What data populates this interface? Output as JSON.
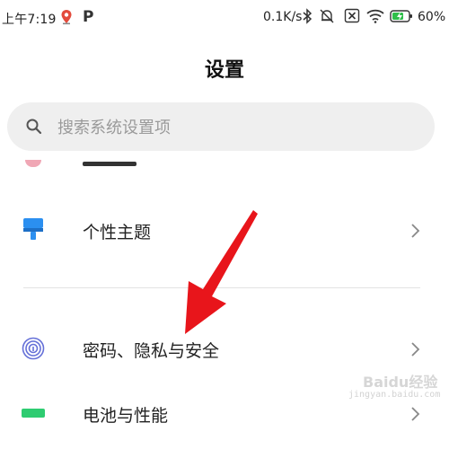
{
  "status_bar": {
    "time": "上午7:19",
    "network_speed": "0.1K/s",
    "battery": "60%",
    "icons": [
      "map-pin-icon",
      "parking-app-icon",
      "bluetooth-icon",
      "mute-icon",
      "sim-off-icon",
      "wifi-icon",
      "battery-charging-icon"
    ]
  },
  "header": {
    "title": "设置"
  },
  "search": {
    "placeholder": "搜索系统设置项",
    "icon": "search-icon"
  },
  "settings": {
    "items": [
      {
        "label": "个性主题",
        "icon": "theme-brush-icon",
        "color": "#2b8ff0"
      },
      {
        "label": "密码、隐私与安全",
        "icon": "fingerprint-icon",
        "color": "#6570d8"
      },
      {
        "label": "电池与性能",
        "icon": "battery-performance-icon",
        "color": "#2ecc71"
      }
    ]
  },
  "annotation": {
    "arrow_color": "#e8151b"
  },
  "watermark": {
    "text": "Baidu经验",
    "sub": "jingyan.baidu.com"
  }
}
